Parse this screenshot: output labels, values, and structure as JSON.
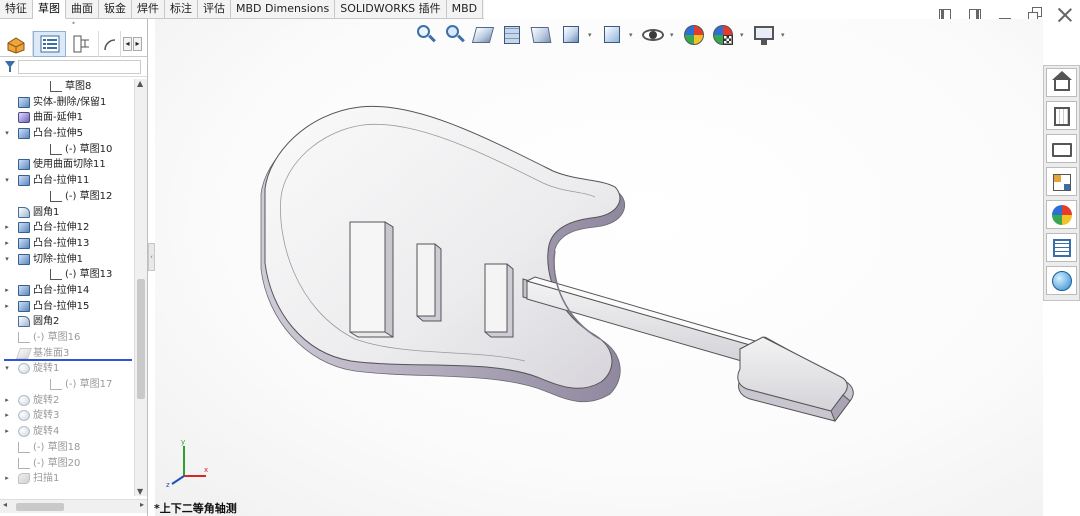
{
  "tabs": [
    {
      "label": "特征"
    },
    {
      "label": "草图"
    },
    {
      "label": "曲面"
    },
    {
      "label": "钣金"
    },
    {
      "label": "焊件"
    },
    {
      "label": "标注"
    },
    {
      "label": "评估"
    },
    {
      "label": "MBD Dimensions"
    },
    {
      "label": "SOLIDWORKS 插件"
    },
    {
      "label": "MBD"
    }
  ],
  "active_tab": "草图",
  "feature_tree": [
    {
      "label": "草图8",
      "icon": "sketch-icon",
      "level": 1,
      "expand": "",
      "suppressed": false
    },
    {
      "label": "实体-删除/保留1",
      "icon": "feature-icon",
      "level": 0,
      "expand": "",
      "suppressed": false
    },
    {
      "label": "曲面-延伸1",
      "icon": "surface-icon",
      "level": 0,
      "expand": "",
      "suppressed": false
    },
    {
      "label": "凸台-拉伸5",
      "icon": "extrude-icon",
      "level": 0,
      "expand": "▾",
      "suppressed": false
    },
    {
      "label": "(-) 草图10",
      "icon": "sketch-icon",
      "level": 1,
      "expand": "",
      "suppressed": false
    },
    {
      "label": "使用曲面切除11",
      "icon": "feature-icon",
      "level": 0,
      "expand": "",
      "suppressed": false
    },
    {
      "label": "凸台-拉伸11",
      "icon": "extrude-icon",
      "level": 0,
      "expand": "▾",
      "suppressed": false
    },
    {
      "label": "(-) 草图12",
      "icon": "sketch-icon",
      "level": 1,
      "expand": "",
      "suppressed": false
    },
    {
      "label": "圆角1",
      "icon": "fillet-icon",
      "level": 0,
      "expand": "",
      "suppressed": false
    },
    {
      "label": "凸台-拉伸12",
      "icon": "extrude-icon",
      "level": 0,
      "expand": "▸",
      "suppressed": false
    },
    {
      "label": "凸台-拉伸13",
      "icon": "extrude-icon",
      "level": 0,
      "expand": "▸",
      "suppressed": false
    },
    {
      "label": "切除-拉伸1",
      "icon": "cut-extrude-icon",
      "level": 0,
      "expand": "▾",
      "suppressed": false
    },
    {
      "label": "(-) 草图13",
      "icon": "sketch-icon",
      "level": 1,
      "expand": "",
      "suppressed": false
    },
    {
      "label": "凸台-拉伸14",
      "icon": "extrude-icon",
      "level": 0,
      "expand": "▸",
      "suppressed": false
    },
    {
      "label": "凸台-拉伸15",
      "icon": "extrude-icon",
      "level": 0,
      "expand": "▸",
      "suppressed": false
    },
    {
      "label": "圆角2",
      "icon": "fillet-icon",
      "level": 0,
      "expand": "",
      "suppressed": false
    },
    {
      "label": "(-) 草图16",
      "icon": "sketch-icon",
      "level": 0,
      "expand": "",
      "suppressed": true
    },
    {
      "label": "基准面3",
      "icon": "plane-icon",
      "level": 0,
      "expand": "",
      "suppressed": true
    },
    {
      "label": "旋转1",
      "icon": "revolve-icon",
      "level": 0,
      "expand": "▾",
      "suppressed": true
    },
    {
      "label": "(-) 草图17",
      "icon": "sketch-icon",
      "level": 1,
      "expand": "",
      "suppressed": true
    },
    {
      "label": "旋转2",
      "icon": "revolve-icon",
      "level": 0,
      "expand": "▸",
      "suppressed": true
    },
    {
      "label": "旋转3",
      "icon": "revolve-icon",
      "level": 0,
      "expand": "▸",
      "suppressed": true
    },
    {
      "label": "旋转4",
      "icon": "revolve-icon",
      "level": 0,
      "expand": "▸",
      "suppressed": true
    },
    {
      "label": "(-) 草图18",
      "icon": "sketch-icon",
      "level": 0,
      "expand": "",
      "suppressed": true
    },
    {
      "label": "(-) 草图20",
      "icon": "sketch-icon",
      "level": 0,
      "expand": "",
      "suppressed": true
    },
    {
      "label": "扫描1",
      "icon": "sweep-icon",
      "level": 0,
      "expand": "▸",
      "suppressed": true
    }
  ],
  "rollback_after": "圆角2",
  "view": {
    "orientation_label": "*上下二等角轴测",
    "triad": {
      "x": "x",
      "y": "y",
      "z": "z"
    }
  },
  "colors": {
    "rollback_bar": "#2f55d4",
    "model_face": "#eeeeef",
    "model_side": "#b9b2c4",
    "accent": "#3d6fa8"
  }
}
